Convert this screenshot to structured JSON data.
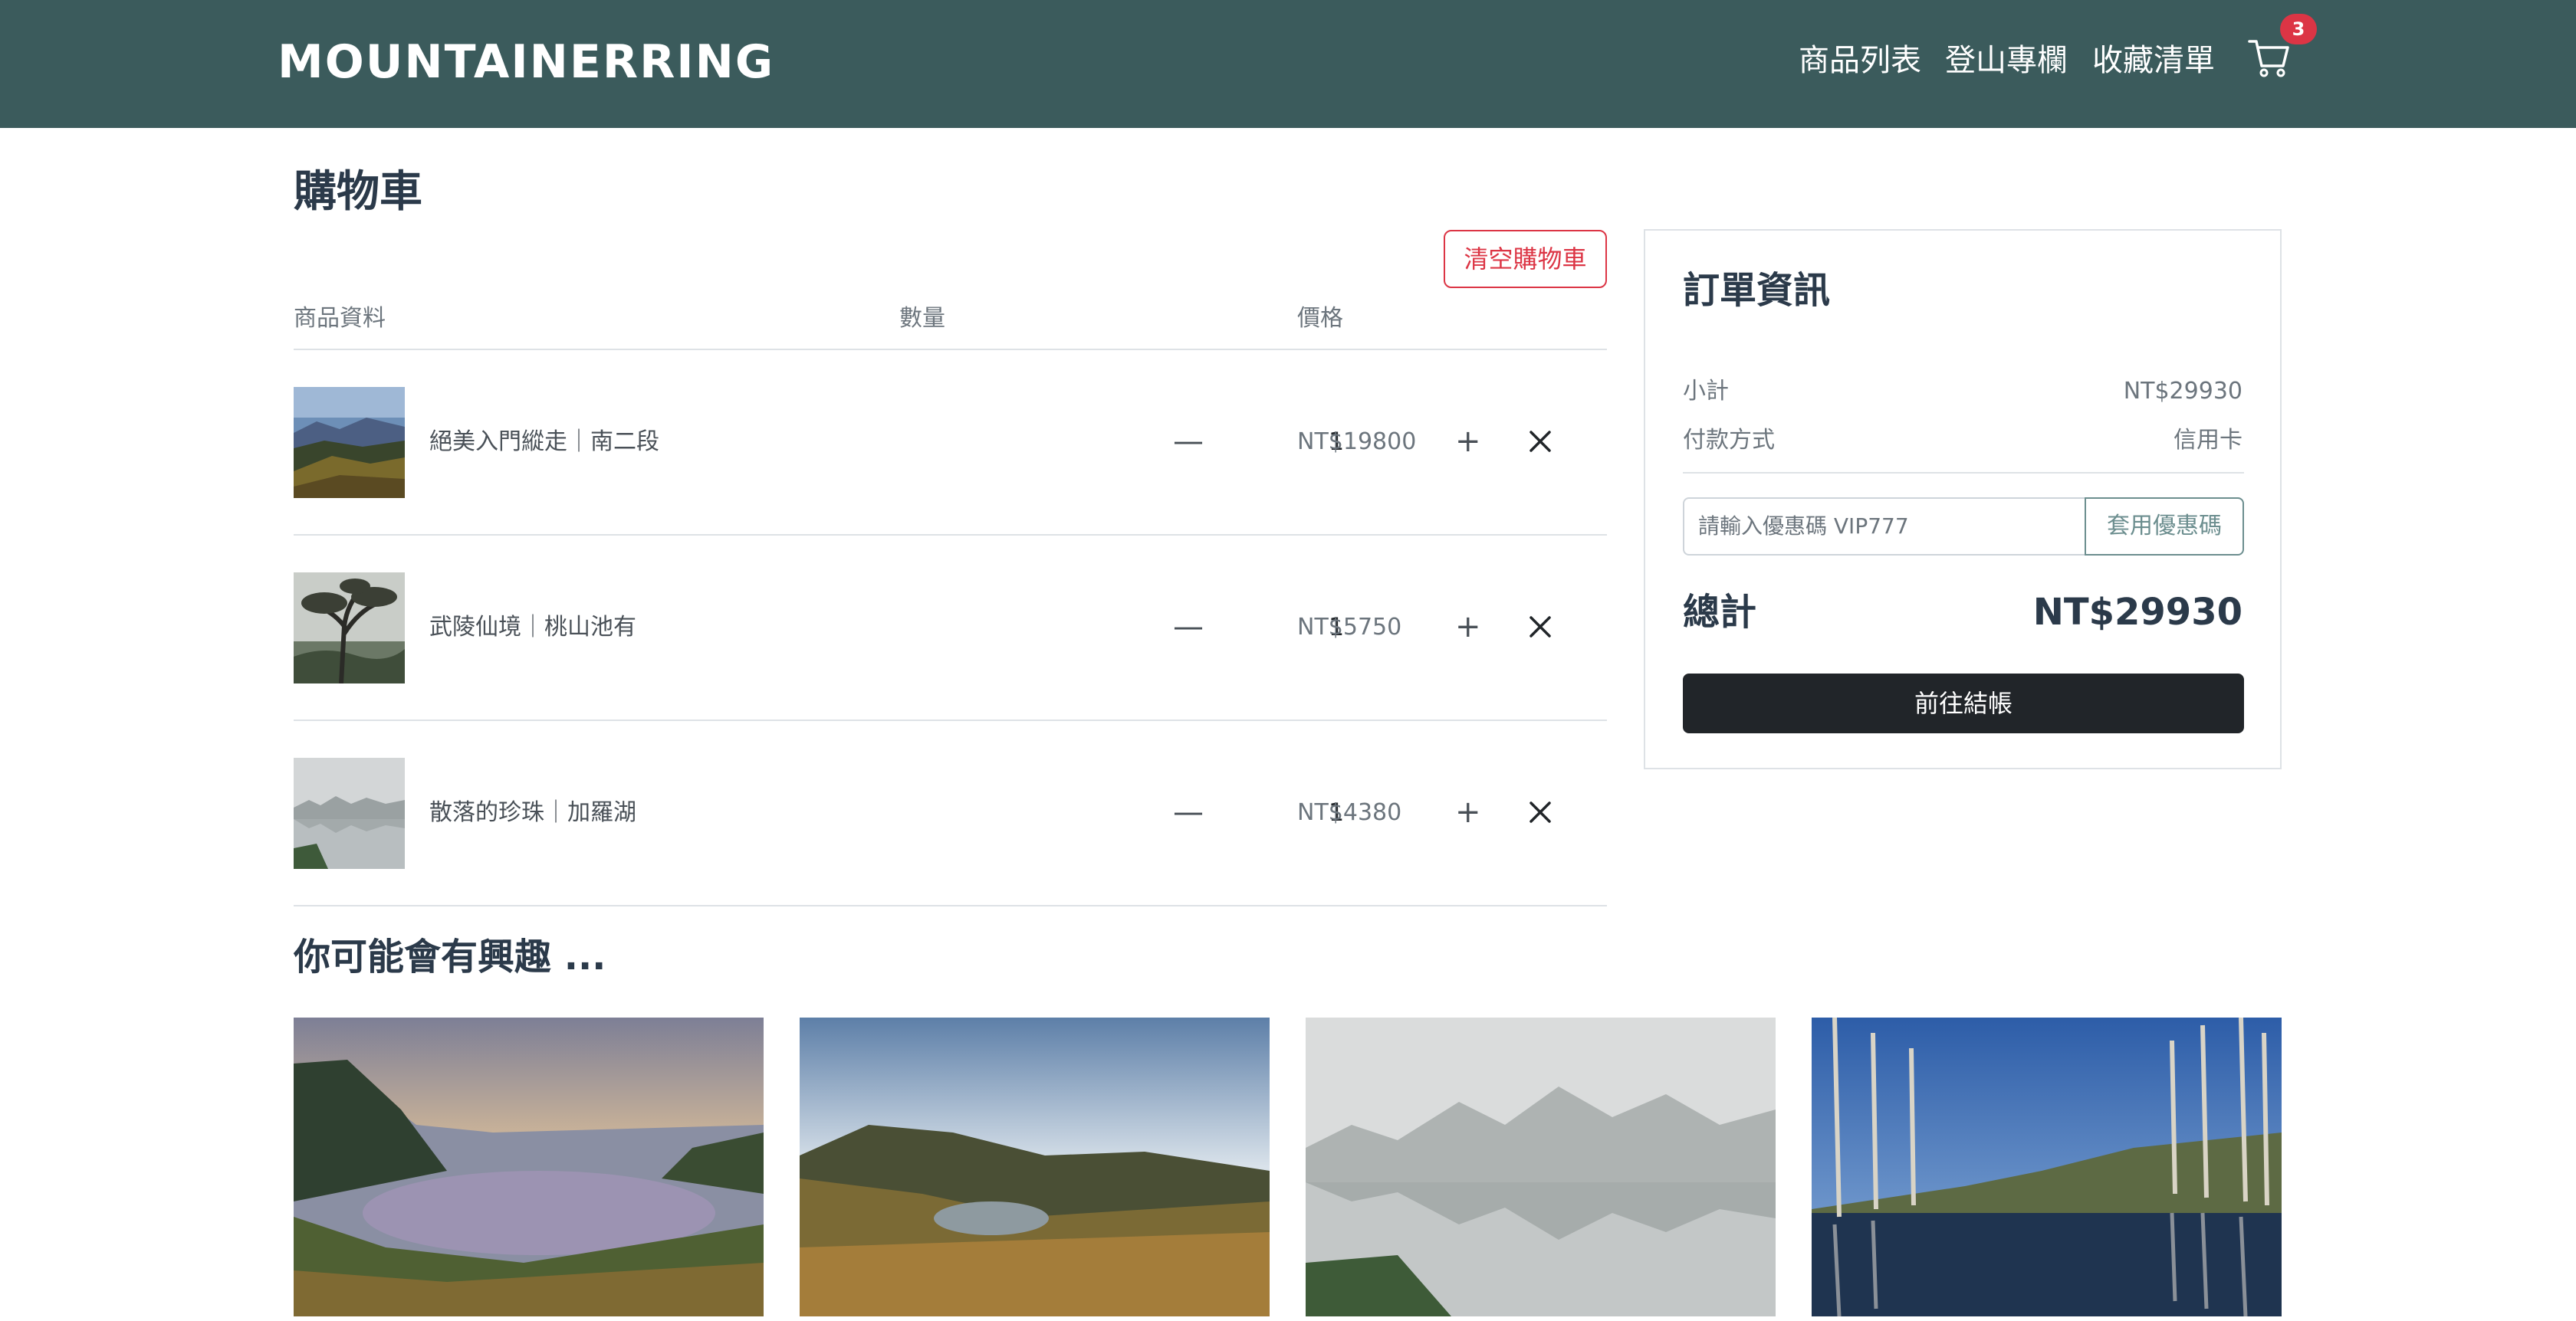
{
  "header": {
    "brand": "MOUNTAINERRING",
    "nav": [
      "商品列表",
      "登山專欄",
      "收藏清單"
    ],
    "cart_icon": "cart-icon",
    "cart_count": "3"
  },
  "cart": {
    "title": "購物車",
    "clear_label": "清空購物車",
    "columns": [
      "商品資料",
      "數量",
      "價格"
    ],
    "items": [
      {
        "name": "絕美入門縱走｜南二段",
        "qty": "1",
        "price": "NT$19800",
        "image_icon": "mountain-ridge-image"
      },
      {
        "name": "武陵仙境｜桃山池有",
        "qty": "1",
        "price": "NT$5750",
        "image_icon": "tree-in-fog-image"
      },
      {
        "name": "散落的珍珠｜加羅湖",
        "qty": "1",
        "price": "NT$4380",
        "image_icon": "misty-lake-image"
      }
    ],
    "minus_symbol": "—",
    "plus_symbol": "+"
  },
  "order": {
    "title": "訂單資訊",
    "subtotal_label": "小計",
    "subtotal_value": "NT$29930",
    "payment_label": "付款方式",
    "payment_value": "信用卡",
    "coupon_placeholder": "請輸入優惠碼 VIP777",
    "coupon_button": "套用優惠碼",
    "total_label": "總計",
    "total_value": "NT$29930",
    "checkout_label": "前往結帳"
  },
  "recommend": {
    "title": "你可能會有興趣 ..."
  },
  "colors": {
    "navbar": "#3b5b5c",
    "danger": "#dc3545",
    "dark": "#212529",
    "accent": "#6c8e8f"
  }
}
